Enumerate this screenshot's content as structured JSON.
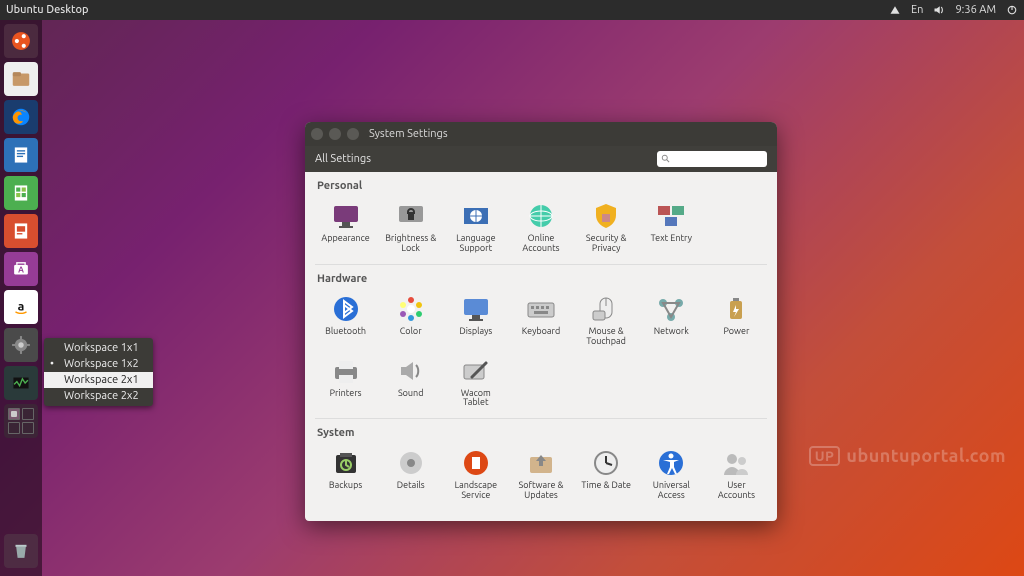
{
  "panel": {
    "title": "Ubuntu Desktop",
    "indicators": {
      "lang": "En",
      "time": "9:36 AM"
    }
  },
  "workspace_menu": {
    "items": [
      "Workspace 1x1",
      "Workspace 1x2",
      "Workspace 2x1",
      "Workspace 2x2"
    ],
    "current": 1,
    "hover": 2
  },
  "window": {
    "title": "System Settings",
    "breadcrumb": "All Settings",
    "search_placeholder": "",
    "sections": {
      "personal": {
        "title": "Personal",
        "items": [
          "Appearance",
          "Brightness & Lock",
          "Language Support",
          "Online Accounts",
          "Security & Privacy",
          "Text Entry"
        ]
      },
      "hardware": {
        "title": "Hardware",
        "items": [
          "Bluetooth",
          "Color",
          "Displays",
          "Keyboard",
          "Mouse & Touchpad",
          "Network",
          "Power"
        ],
        "items2": [
          "Printers",
          "Sound",
          "Wacom Tablet"
        ]
      },
      "system": {
        "title": "System",
        "items": [
          "Backups",
          "Details",
          "Landscape Service",
          "Software & Updates",
          "Time & Date",
          "Universal Access",
          "User Accounts"
        ]
      }
    }
  },
  "watermark": {
    "logo": "UP",
    "text": "ubuntuportal.com"
  },
  "colors": {
    "orange": "#dd4814",
    "purple": "#77216f",
    "blue": "#3d8ec9"
  }
}
